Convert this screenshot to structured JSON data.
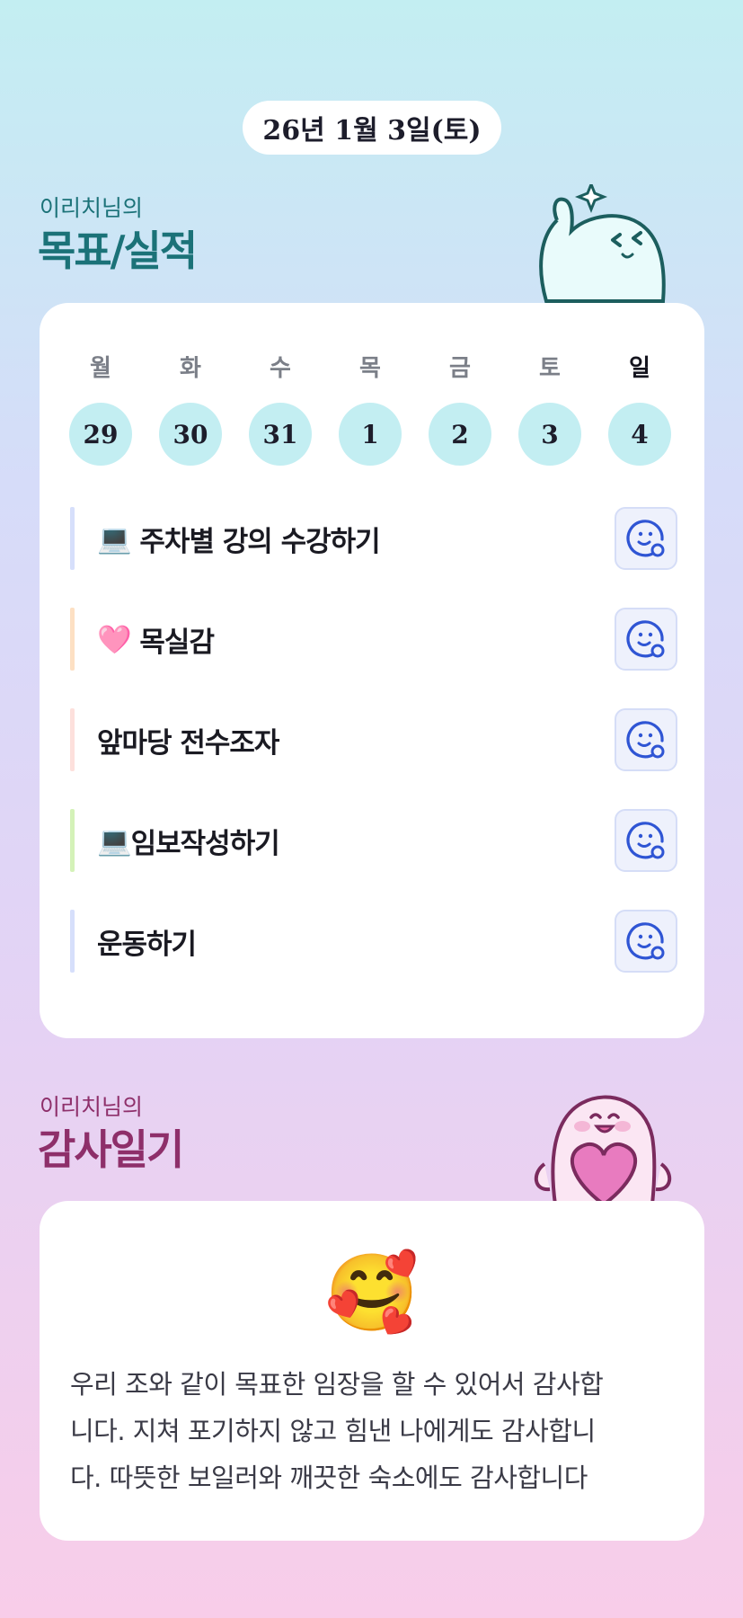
{
  "header": {
    "date": "26년 1월 3일(토)"
  },
  "goals_section": {
    "subtitle": "이리치님의",
    "title": "목표/실적",
    "weekdays": [
      "월",
      "화",
      "수",
      "목",
      "금",
      "토",
      "일"
    ],
    "dates": [
      "29",
      "30",
      "31",
      "1",
      "2",
      "3",
      "4"
    ],
    "goals": [
      {
        "emoji": "💻",
        "text": "주차별 강의 수강하기",
        "bar_color": "#d6dffb"
      },
      {
        "emoji": "🩷",
        "text": "목실감",
        "bar_color": "#fde0c3"
      },
      {
        "emoji": "",
        "text": "앞마당 전수조자",
        "bar_color": "#fde0dc"
      },
      {
        "emoji": "💻",
        "text": "임보작성하기",
        "bar_color": "#d4f2b8"
      },
      {
        "emoji": "",
        "text": "운동하기",
        "bar_color": "#d6dffb"
      }
    ]
  },
  "thanks_section": {
    "subtitle": "이리치님의",
    "title": "감사일기",
    "emoji": "🥰",
    "lines": [
      "우리 조와 같이 목표한 임장을 할 수 있어서 감사합",
      "니다. 지쳐 포기하지 않고 힘낸 나에게도 감사합니",
      "다. 따뜻한 보일러와 깨끗한 숙소에도 감사합니다"
    ]
  },
  "colors": {
    "goals_title": "#1b7278",
    "thanks_title": "#8e2f6a",
    "day_circle": "#c3eef2",
    "button_icon": "#2f55d4"
  },
  "icons": [
    "smile-feedback-icon",
    "sparkle-icon",
    "heart-icon"
  ]
}
